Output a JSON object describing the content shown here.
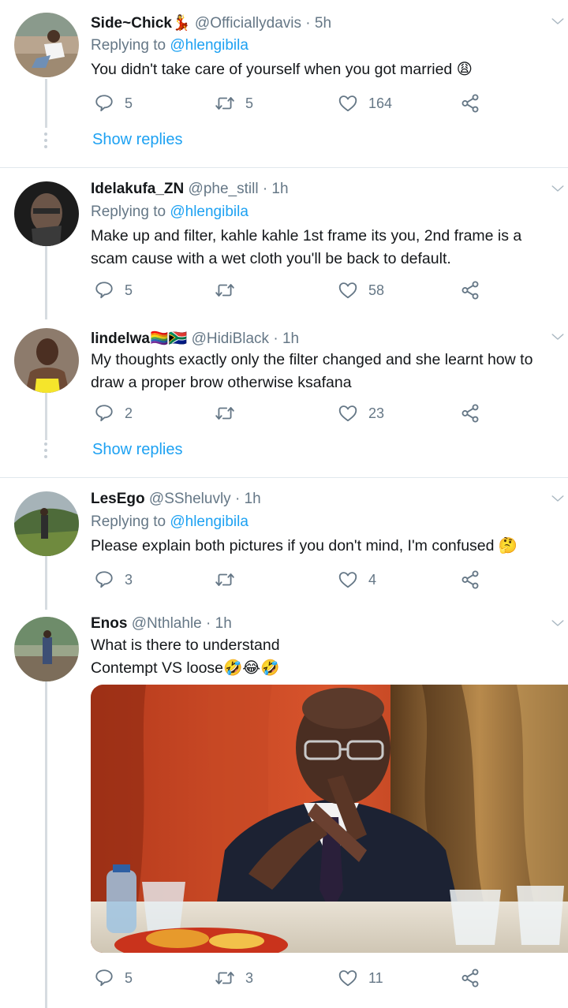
{
  "tweets": [
    {
      "name": "Side~Chick",
      "emoji": "💃",
      "handle": "@Officiallydavis",
      "time": "· 5h",
      "replying_prefix": "Replying to ",
      "replying_to": "@hlengibila",
      "text": "You didn't take care of yourself when you got married 😩",
      "replies": "5",
      "retweets": "5",
      "likes": "164",
      "show_replies": "Show replies"
    },
    {
      "name": "Idelakufa_ZN",
      "handle": "@phe_still",
      "time": "· 1h",
      "replying_prefix": "Replying to ",
      "replying_to": "@hlengibila",
      "text": "Make up and filter, kahle kahle 1st frame its you, 2nd frame is a scam cause with a wet cloth you'll be back to default.",
      "replies": "5",
      "retweets": "",
      "likes": "58"
    },
    {
      "name": "lindelwa",
      "emoji": "🏳️‍🌈🇿🇦",
      "handle": "@HidiBlack",
      "time": "· 1h",
      "text": "My thoughts exactly only the filter changed and she learnt how to draw a proper brow otherwise ksafana",
      "replies": "2",
      "retweets": "",
      "likes": "23",
      "show_replies": "Show replies"
    },
    {
      "name": "LesEgo",
      "handle": "@SSheluvly",
      "time": "· 1h",
      "replying_prefix": "Replying to ",
      "replying_to": "@hlengibila",
      "text": "Please explain both pictures if you don't mind, I'm confused 🤔",
      "replies": "3",
      "retweets": "",
      "likes": "4"
    },
    {
      "name": "Enos",
      "handle": "@Nthlahle",
      "time": "· 1h",
      "text_line1": "What is there to understand",
      "text_line2": "Contempt VS loose🤣😂🤣",
      "replies": "5",
      "retweets": "3",
      "likes": "11"
    }
  ],
  "colors": {
    "link": "#1da1f2",
    "muted": "#657786",
    "text": "#14171a",
    "divider": "#e1e8ed"
  },
  "icons": [
    "reply-icon",
    "retweet-icon",
    "like-icon",
    "share-icon",
    "chevron-down-icon"
  ]
}
